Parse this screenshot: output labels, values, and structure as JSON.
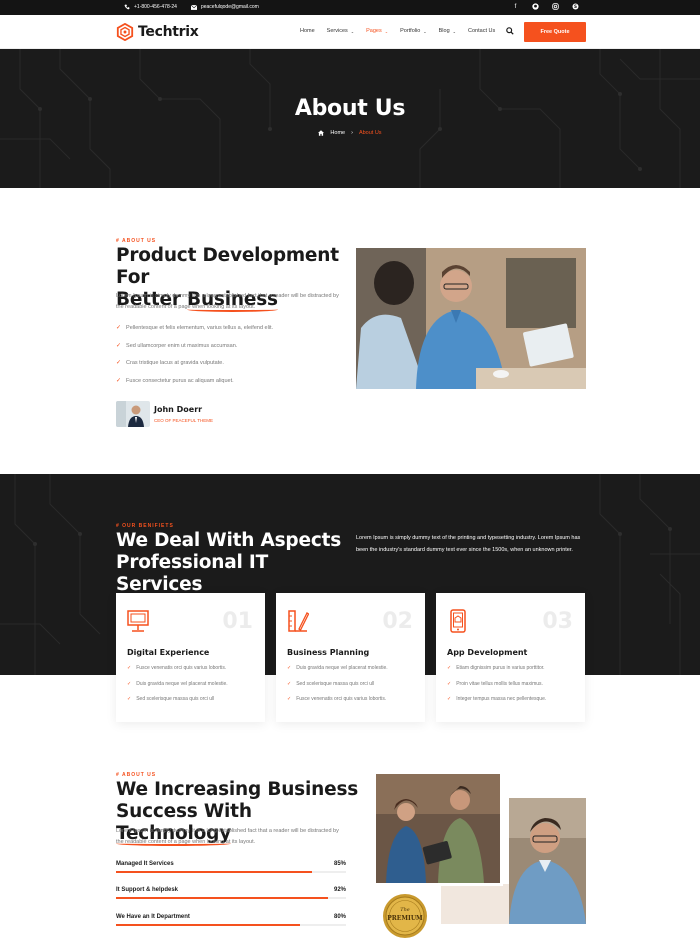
{
  "topbar": {
    "phone": "+1-800-456-478-24",
    "email": "peacefulqode@gmail.com",
    "socials": [
      "facebook-icon",
      "github-icon",
      "instagram-icon",
      "skype-icon"
    ]
  },
  "nav": {
    "brand": "Techtrix",
    "menu": [
      {
        "label": "Home",
        "caret": false,
        "active": false
      },
      {
        "label": "Services",
        "caret": true,
        "active": false
      },
      {
        "label": "Pages",
        "caret": true,
        "active": true
      },
      {
        "label": "Portfolio",
        "caret": true,
        "active": false
      },
      {
        "label": "Blog",
        "caret": true,
        "active": false
      },
      {
        "label": "Contact Us",
        "caret": false,
        "active": false
      }
    ],
    "cta": "Free Quote"
  },
  "hero": {
    "title": "About Us",
    "breadcrumb_home": "Home",
    "breadcrumb_sep": "›",
    "breadcrumb_current": "About Us"
  },
  "about": {
    "eyebrow": "# ABOUT US",
    "title_line1": "Product Development For",
    "title_line2_pre": "Better ",
    "title_line2_em": "Business",
    "lead": "Lorem Ipsum is simply dummy It is a long established fact that a reader will be distracted by the readable content of a page when looking at its layout.",
    "points": [
      "Pellentesque et felis elementum, varius tellus a, eleifend elit.",
      "Sed ullamcorper enim ut maximus accumsan.",
      "Cras tristique lacus at gravida vulputate.",
      "Fusce consectetur purus ac aliquam aliquet."
    ],
    "author_name": "John Doerr",
    "author_role": "CEO OF PEACEFUL THEME"
  },
  "benefits": {
    "eyebrow": "# OUR BENIFIETS",
    "title_line1": "We Deal With Aspects",
    "title_line2": "Professional IT Services",
    "lead": "Lorem Ipsum is simply dummy text of the printing and typesetting industry. Lorem Ipsum has been the industry's standard dummy text ever since the 1500s, when an unknown printer.",
    "cards": [
      {
        "num": "01",
        "title": "Digital Experience",
        "icon": "monitor-icon",
        "items": [
          "Fusce venenatis orci quis varius lobortis.",
          "Duis gravida neque vel placerat molestie.",
          "Sed scelerisque massa quis orci ull"
        ]
      },
      {
        "num": "02",
        "title": "Business Planning",
        "icon": "pen-ruler-icon",
        "items": [
          "Duis gravida neque vel placerat molestie.",
          "Sed scelerisque massa quis orci ull",
          "Fusce venenatis orci quis varius lobortis."
        ]
      },
      {
        "num": "03",
        "title": "App Development",
        "icon": "mobile-app-icon",
        "items": [
          "Etiam dignissim purus in varius porttitor.",
          "Proin vitae tellus mollis tellus maximus.",
          "Integer tempus massa nec pellentesque."
        ]
      }
    ]
  },
  "growth": {
    "eyebrow": "# ABOUT US",
    "title_line1": "We Increasing Business",
    "title_line2_pre": "Success With ",
    "title_line2_em": "Technology",
    "lead": "Lorem Ipsum is simply dummy It is a long established fact that a reader will be distracted by the readable content of a page when looking at its layout.",
    "skills": [
      {
        "label": "Managed It Services",
        "pct": "85%",
        "value": 85
      },
      {
        "label": "It Support & helpdesk",
        "pct": "92%",
        "value": 92
      },
      {
        "label": "We Have an It Department",
        "pct": "80%",
        "value": 80
      }
    ],
    "badge_top": "The",
    "badge_text": "PREMIUM"
  },
  "colors": {
    "accent": "#f5511e",
    "dark": "#1b1b1b",
    "topbar": "#141414"
  }
}
